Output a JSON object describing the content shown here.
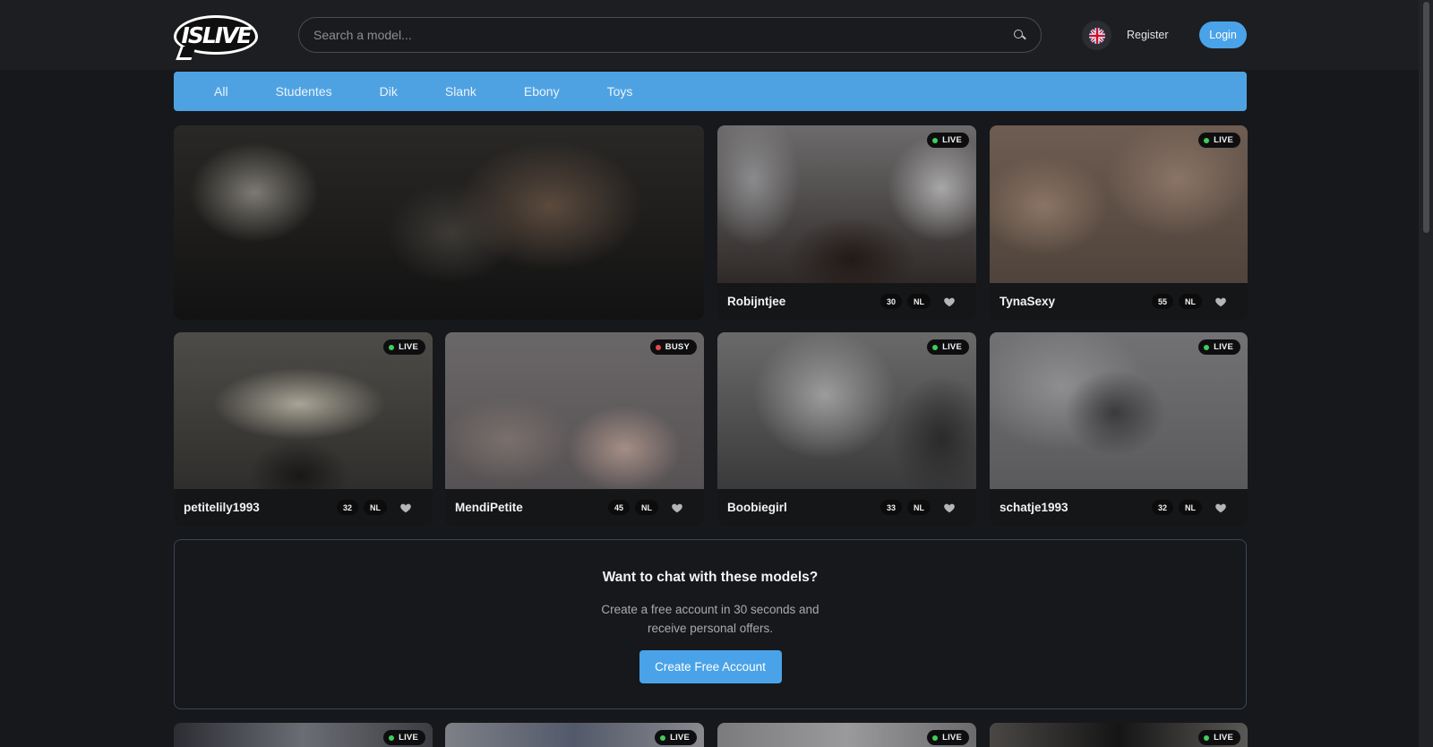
{
  "header": {
    "logo_text": "ISLIVE",
    "search_placeholder": "Search a model...",
    "language_icon": "uk-flag-icon",
    "register_label": "Register",
    "login_label": "Login"
  },
  "categories": [
    "All",
    "Studentes",
    "Dik",
    "Slank",
    "Ebony",
    "Toys"
  ],
  "models": [
    {
      "name": "Robijntjee",
      "age": "30",
      "lang": "NL",
      "status": "LIVE"
    },
    {
      "name": "TynaSexy",
      "age": "55",
      "lang": "NL",
      "status": "LIVE"
    },
    {
      "name": "petitelily1993",
      "age": "32",
      "lang": "NL",
      "status": "LIVE"
    },
    {
      "name": "MendiPetite",
      "age": "45",
      "lang": "NL",
      "status": "BUSY"
    },
    {
      "name": "Boobiegirl",
      "age": "33",
      "lang": "NL",
      "status": "LIVE"
    },
    {
      "name": "schatje1993",
      "age": "32",
      "lang": "NL",
      "status": "LIVE"
    }
  ],
  "bottom_row_status": [
    "LIVE",
    "LIVE",
    "LIVE",
    "LIVE"
  ],
  "cta": {
    "title": "Want to chat with these models?",
    "text": "Create a free account in 30 seconds and receive personal offers.",
    "button_label": "Create Free Account"
  },
  "colors": {
    "accent": "#4aa3e8",
    "live_dot": "#3ecf5a",
    "busy_dot": "#e5484d"
  }
}
